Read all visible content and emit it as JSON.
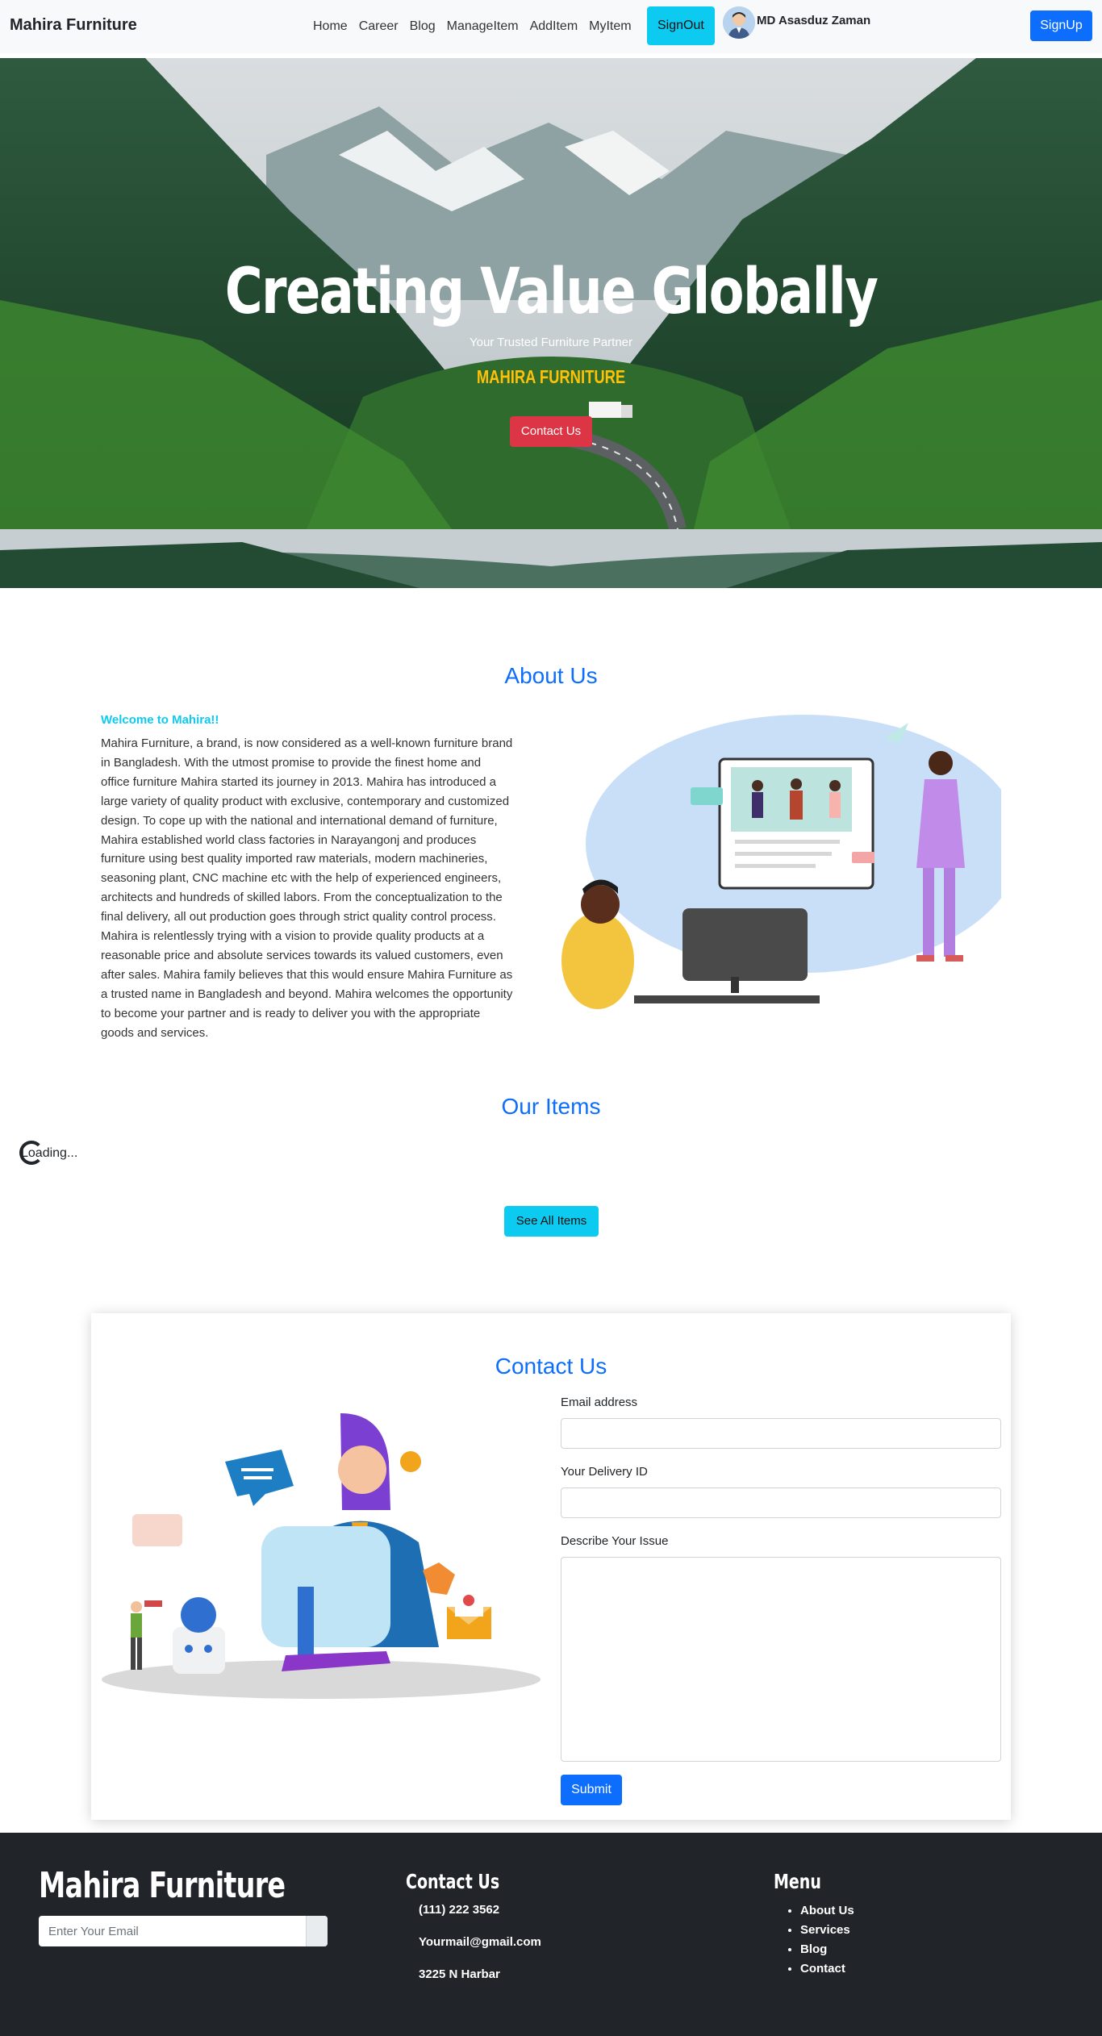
{
  "navbar": {
    "brand": "Mahira Furniture",
    "links": [
      "Home",
      "Career",
      "Blog",
      "ManageItem",
      "AddItem",
      "MyItem"
    ],
    "signout_label": "SignOut",
    "user_name": "MD Asasduz Zaman",
    "signup_label": "SignUp"
  },
  "hero": {
    "title": "Creating Value Globally",
    "subtitle": "Your Trusted Furniture Partner",
    "brand": "MAHIRA FURNITURE",
    "cta_label": "Contact Us"
  },
  "about": {
    "title": "About Us",
    "welcome": "Welcome to Mahira!!",
    "lines": [
      "Mahira Furniture, a brand, is now considered as a well-known furniture brand",
      "in Bangladesh. With the utmost promise to provide the finest home and",
      "office furniture Mahira started its journey in 2013. Mahira has introduced a",
      "large variety of quality product with exclusive, contemporary and customized",
      "design. To cope up with the national and international demand of furniture,",
      "Mahira established world class factories in Narayangonj and produces",
      "furniture using best quality imported raw materials, modern machineries,",
      "seasoning plant, CNC machine etc with the help of experienced engineers,",
      "architects and hundreds of skilled labors. From the conceptualization to the",
      "final delivery, all out production goes through strict quality control process.",
      "Mahira is relentlessly trying with a vision to provide quality products at a",
      "reasonable price and absolute services towards its valued customers, even",
      "after sales. Mahira family believes that this would ensure Mahira Furniture as",
      "a trusted name in Bangladesh and beyond. Mahira welcomes the opportunity",
      "to become your partner and is ready to deliver you with the appropriate",
      "goods and services."
    ]
  },
  "items": {
    "title": "Our Items",
    "loading": "Loading...",
    "see_all_label": "See All Items"
  },
  "contact": {
    "title": "Contact Us",
    "email_label": "Email address",
    "delivery_label": "Your Delivery ID",
    "issue_label": "Describe Your Issue",
    "submit_label": "Submit"
  },
  "footer": {
    "brand": "Mahira Furniture",
    "email_placeholder": "Enter Your Email",
    "contact_title": "Contact Us",
    "phone": "(111) 222 3562",
    "email": "Yourmail@gmail.com",
    "address": "3225 N Harbar",
    "menu_title": "Menu",
    "menu": [
      "About Us",
      "Services",
      "Blog",
      "Contact"
    ]
  },
  "colors": {
    "primary": "#0d6efd",
    "info": "#0dcaf0",
    "danger": "#dc3545",
    "warning": "#ffc107",
    "dark": "#212529"
  }
}
